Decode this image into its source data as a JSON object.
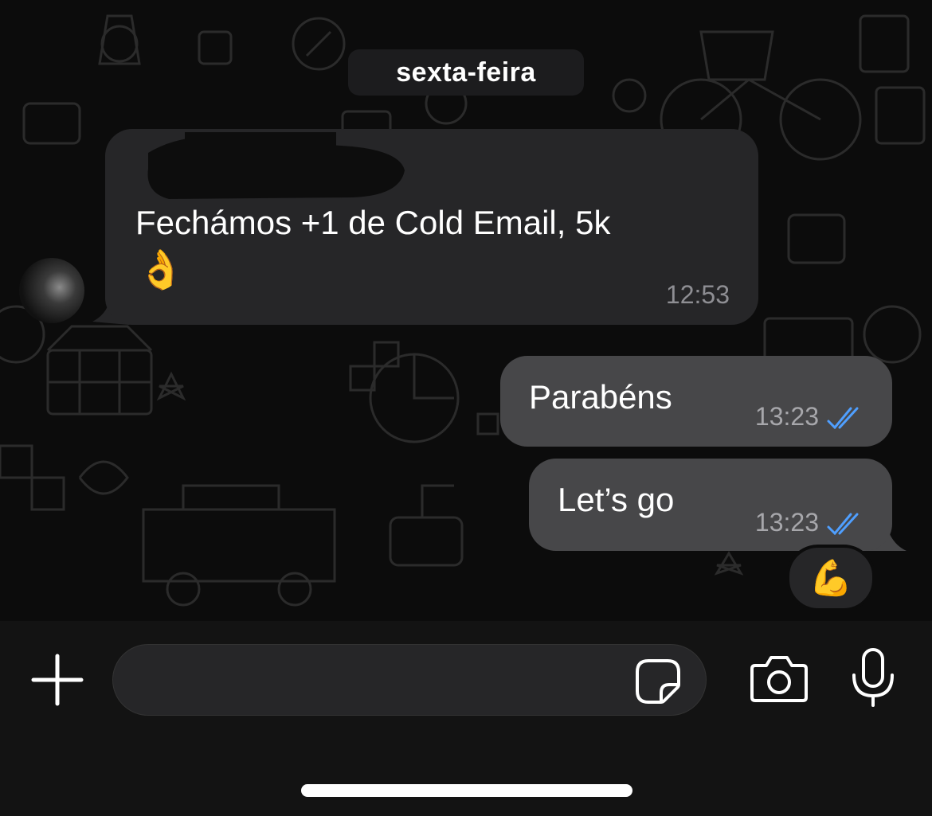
{
  "chat": {
    "date_separator": "sexta-feira",
    "messages": [
      {
        "direction": "incoming",
        "text": "Fechámos +1 de Cold Email, 5k",
        "emoji": "👌",
        "time": "12:53"
      },
      {
        "direction": "outgoing",
        "text": "Parabéns",
        "time": "13:23",
        "status": "read"
      },
      {
        "direction": "outgoing",
        "text": "Let’s go",
        "time": "13:23",
        "status": "read",
        "reaction": "💪"
      }
    ]
  },
  "composer": {
    "placeholder": "",
    "value": ""
  },
  "colors": {
    "background": "#0c0c0c",
    "incoming_bubble": "#262628",
    "outgoing_bubble": "#474749",
    "read_ticks": "#4f9fff",
    "timestamp": "#8e8e93"
  },
  "icons": {
    "add": "plus-icon",
    "sticker": "sticker-icon",
    "camera": "camera-icon",
    "mic": "microphone-icon",
    "status": "double-check-icon"
  }
}
